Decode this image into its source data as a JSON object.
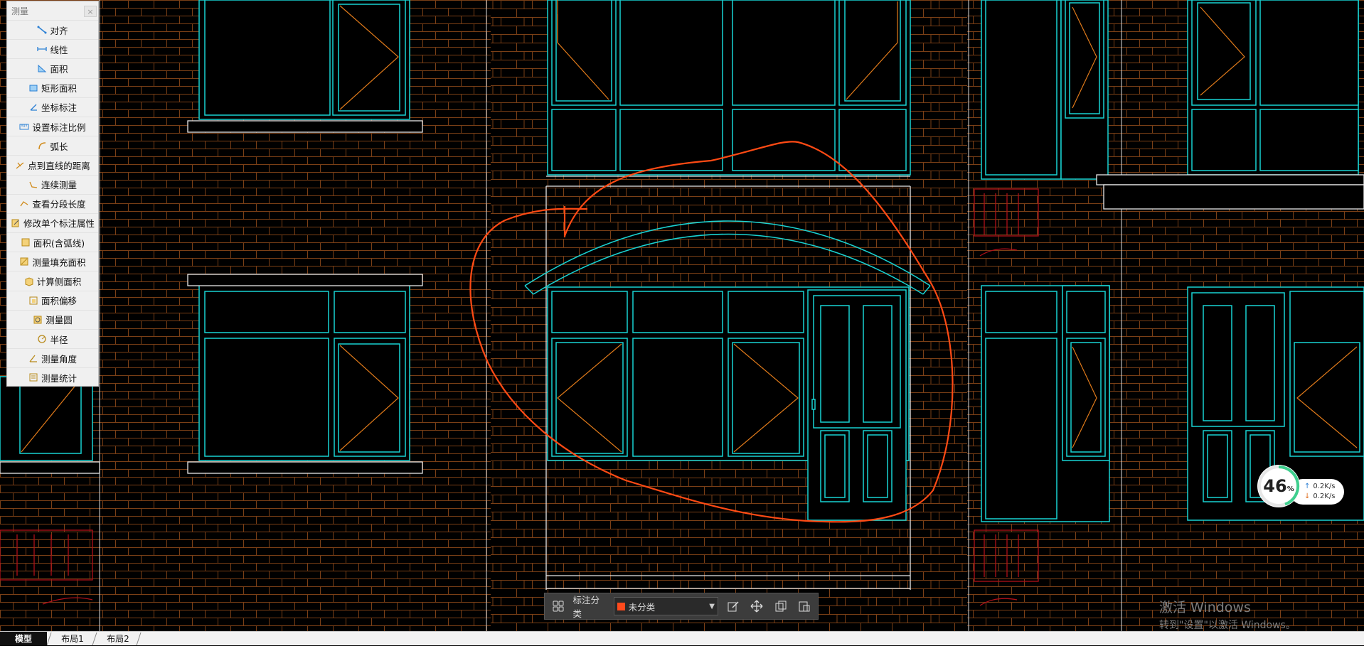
{
  "panel": {
    "title": "测量",
    "close": "×",
    "items": [
      {
        "label": "对齐",
        "icon": "align-measure-icon"
      },
      {
        "label": "线性",
        "icon": "linear-measure-icon"
      },
      {
        "label": "面积",
        "icon": "area-icon"
      },
      {
        "label": "矩形面积",
        "icon": "rect-area-icon"
      },
      {
        "label": "坐标标注",
        "icon": "coordinate-icon"
      },
      {
        "label": "设置标注比例",
        "icon": "scale-icon"
      },
      {
        "label": "弧长",
        "icon": "arc-length-icon"
      },
      {
        "label": "点到直线的距离",
        "icon": "point-line-distance-icon"
      },
      {
        "label": "连续测量",
        "icon": "continuous-measure-icon"
      },
      {
        "label": "查看分段长度",
        "icon": "segment-length-icon"
      },
      {
        "label": "修改单个标注属性",
        "icon": "edit-annotation-icon"
      },
      {
        "label": "面积(含弧线)",
        "icon": "arc-area-icon"
      },
      {
        "label": "测量填充面积",
        "icon": "fill-area-icon"
      },
      {
        "label": "计算侧面积",
        "icon": "side-area-icon"
      },
      {
        "label": "面积偏移",
        "icon": "area-offset-icon"
      },
      {
        "label": "测量圆",
        "icon": "circle-measure-icon"
      },
      {
        "label": "半径",
        "icon": "radius-icon"
      },
      {
        "label": "测量角度",
        "icon": "angle-icon"
      },
      {
        "label": "测量统计",
        "icon": "statistics-icon"
      }
    ]
  },
  "tabs": [
    {
      "label": "模型",
      "active": true
    },
    {
      "label": "布局1",
      "active": false
    },
    {
      "label": "布局2",
      "active": false
    }
  ],
  "annotation_bar": {
    "label": "标注分类",
    "selected": "未分类",
    "swatch_color": "#ff4a1c",
    "tools": [
      "grid-icon",
      "edit-icon",
      "move-icon",
      "copy-icon",
      "paste-icon"
    ]
  },
  "speed_widget": {
    "percent": "46",
    "percent_sign": "%",
    "upload": "0.2K/s",
    "download": "0.2K/s"
  },
  "watermark": {
    "line1": "激活 Windows",
    "line2": "转到\"设置\"以激活 Windows。"
  },
  "colors": {
    "background": "#000000",
    "brick": "#8a4a1c",
    "window_frame": "#19d2d2",
    "cross_lines": "#e07a1a",
    "annotation_ellipse": "#ff4a14",
    "ledge": "#e8e8e8",
    "red_detail": "#b0101a"
  }
}
